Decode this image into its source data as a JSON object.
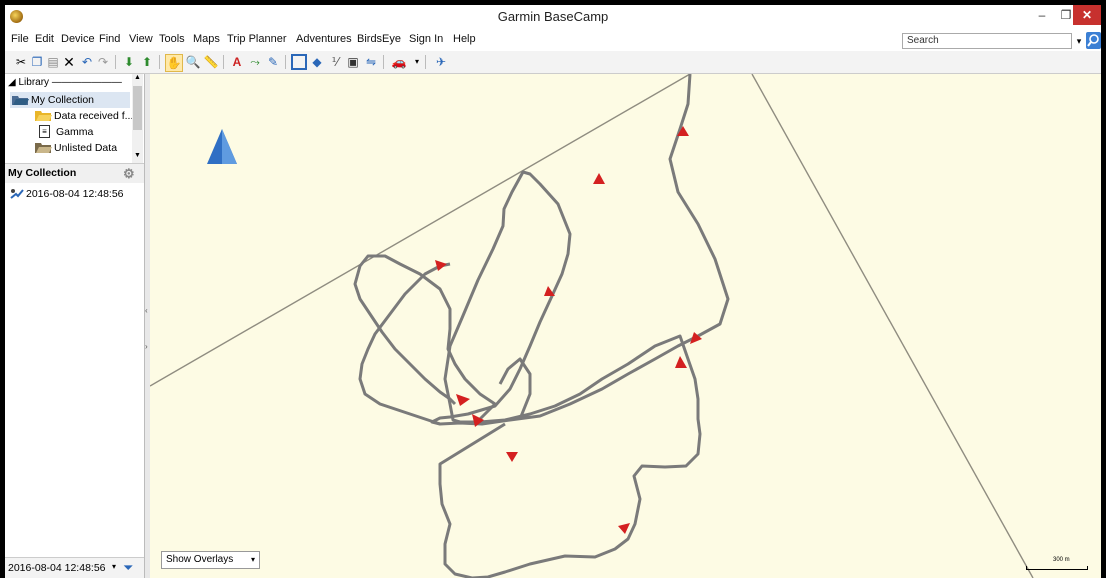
{
  "window": {
    "title": "Garmin BaseCamp"
  },
  "menu": [
    "File",
    "Edit",
    "Device",
    "Find",
    "View",
    "Tools",
    "Maps",
    "Trip Planner",
    "Adventures",
    "BirdsEye",
    "Sign In",
    "Help"
  ],
  "search": {
    "placeholder": "Search"
  },
  "library": {
    "header": "Library",
    "items": [
      {
        "label": "My Collection",
        "icon": "open-folder-icon"
      },
      {
        "label": "Data received f...",
        "icon": "folder-icon"
      },
      {
        "label": "Gamma",
        "icon": "document-icon"
      },
      {
        "label": "Unlisted Data",
        "icon": "folder-icon"
      }
    ]
  },
  "collection": {
    "title": "My Collection",
    "items": [
      {
        "label": "2016-08-04 12:48:56",
        "icon": "track-icon"
      }
    ]
  },
  "bottom": {
    "selected": "2016-08-04 12:48:56"
  },
  "map": {
    "overlay_select": "Show Overlays",
    "scale_label": "300 m"
  },
  "colors": {
    "track": "#7a7a7a",
    "map_bg": "#fdfbe4",
    "arrow": "#d42020"
  }
}
